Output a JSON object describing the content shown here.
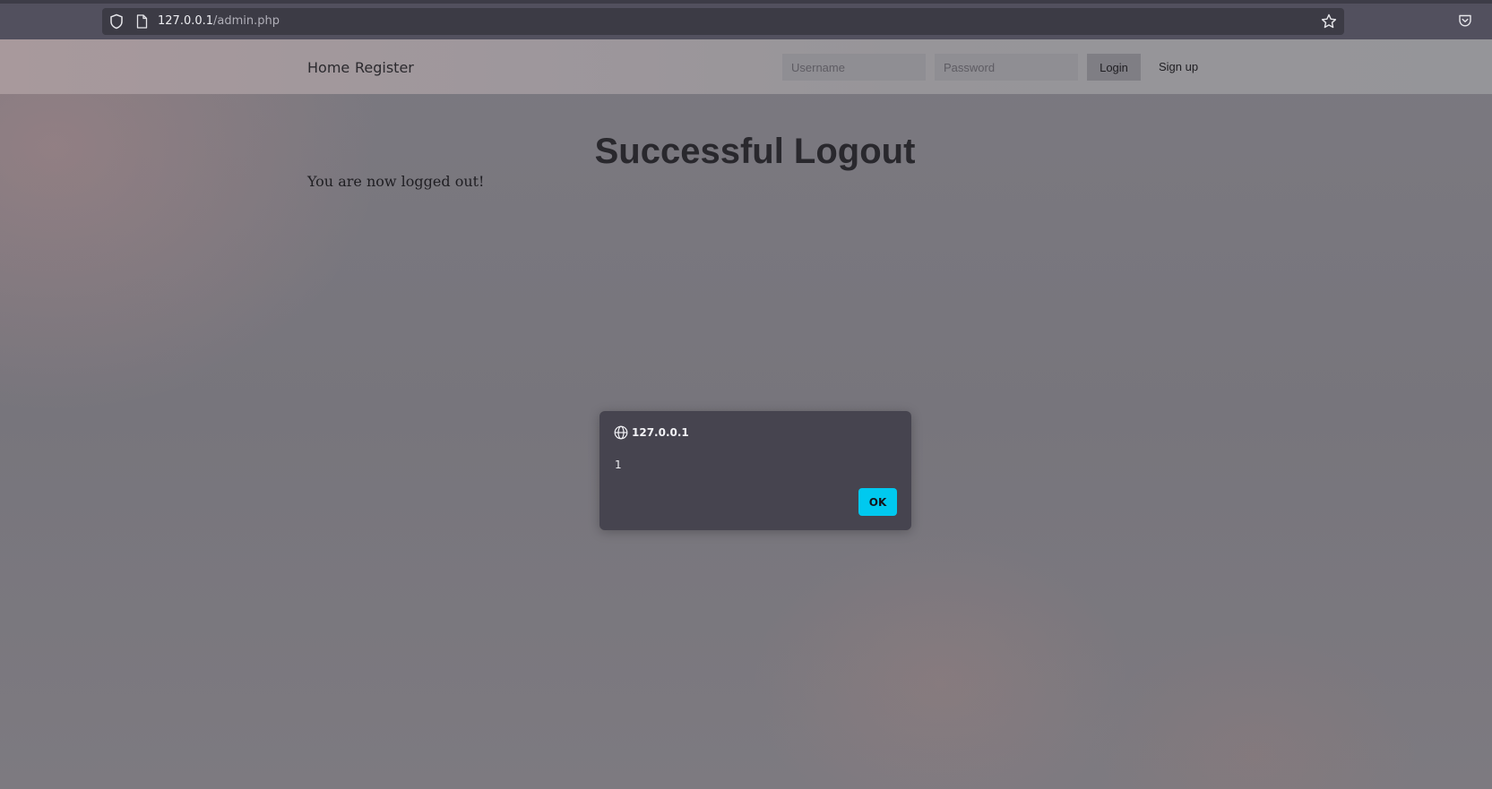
{
  "browser": {
    "url_host": "127.0.0.1",
    "url_path": "/admin.php"
  },
  "nav": {
    "links": [
      "Home",
      "Register"
    ],
    "username_placeholder": "Username",
    "password_placeholder": "Password",
    "login_label": "Login",
    "signup_label": "Sign up"
  },
  "main": {
    "title": "Successful Logout",
    "message": "You are now logged out!"
  },
  "dialog": {
    "origin": "127.0.0.1",
    "message": "1",
    "ok_label": "OK",
    "accent_color": "#00c9ef"
  },
  "icons": [
    "shield-icon",
    "page-icon",
    "star-icon",
    "pocket-icon",
    "globe-icon"
  ]
}
